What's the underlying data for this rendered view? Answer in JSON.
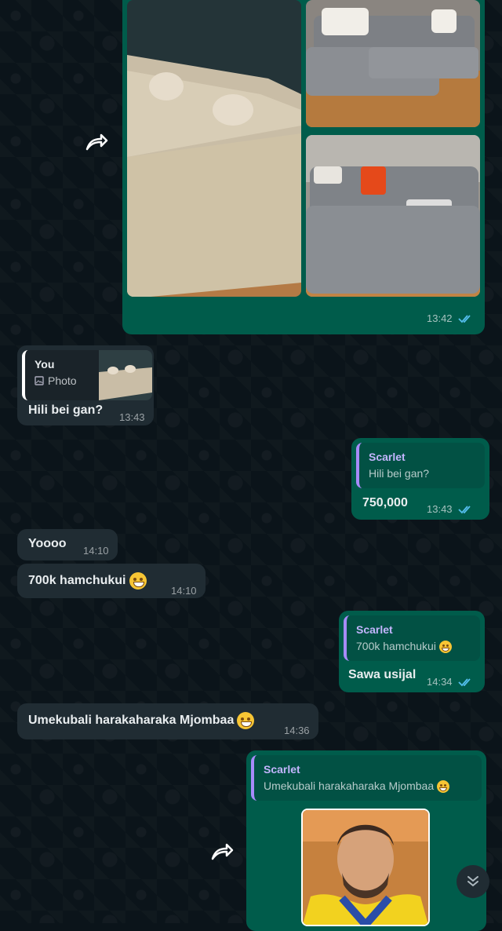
{
  "album": {
    "time": "13:42"
  },
  "reply_photo": {
    "quote_name": "You",
    "quote_label": "Photo",
    "text": "Hili bei gan?",
    "time": "13:43"
  },
  "price_reply": {
    "quote_name": "Scarlet",
    "quote_text": "Hili bei gan?",
    "text": "750,000",
    "time": "13:43"
  },
  "msg_yoooo": {
    "text": "Yoooo",
    "time": "14:10"
  },
  "msg_700k": {
    "text": "700k hamchukui",
    "time": "14:10"
  },
  "sawa_reply": {
    "quote_name": "Scarlet",
    "quote_text": "700k hamchukui",
    "text": "Sawa usijal",
    "time": "14:34"
  },
  "msg_umekubali": {
    "text": "Umekubali harakaharaka Mjombaa",
    "time": "14:36"
  },
  "sticker_reply": {
    "quote_name": "Scarlet",
    "quote_text": "Umekubali harakaharaka Mjombaa"
  },
  "colors": {
    "incoming": "#202c33",
    "outgoing": "#005c4b",
    "read_ticks": "#53bdeb",
    "quote_bar": "#a78bfa"
  },
  "icons": [
    "forward-icon",
    "double-check-icon",
    "smile-emoji-icon",
    "chevron-down-icon",
    "image-icon"
  ]
}
